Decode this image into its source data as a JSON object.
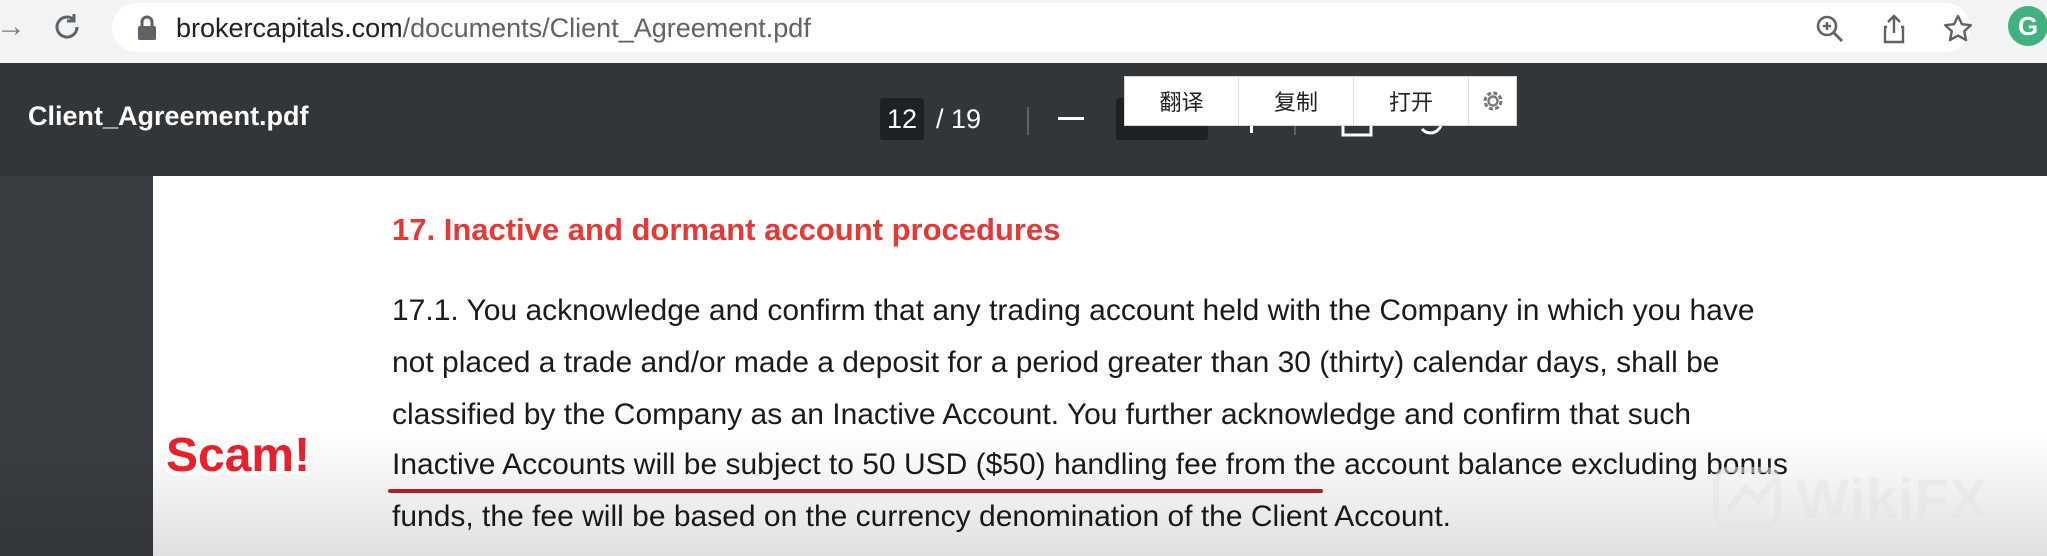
{
  "browser": {
    "url_domain": "brokercapitals.com",
    "url_path": "/documents/Client_Agreement.pdf",
    "extension_label": "G"
  },
  "pdf_toolbar": {
    "title": "Client_Agreement.pdf",
    "current_page": "12",
    "total_pages": "/ 19"
  },
  "context_menu": {
    "translate": "翻译",
    "copy": "复制",
    "open": "打开"
  },
  "document": {
    "heading": "17. Inactive and dormant account procedures",
    "lines": [
      "17.1. You acknowledge and confirm that any trading account held with the Company in which you have",
      "not placed a trade and/or made a deposit for a period greater than 30 (thirty) calendar days, shall be",
      "classified by the Company as an Inactive Account. You further acknowledge and confirm that such",
      "Inactive Accounts will be subject to 50 USD ($50) handling fee from the account balance excluding bonus",
      "funds, the fee will be based on the currency denomination of the Client Account."
    ]
  },
  "overlay": {
    "scam_label": "Scam!",
    "watermark": "WikiFX"
  },
  "colors": {
    "heading_red": "#e53935",
    "underline_red": "#c41e24",
    "toolbar_bg": "#323639"
  }
}
